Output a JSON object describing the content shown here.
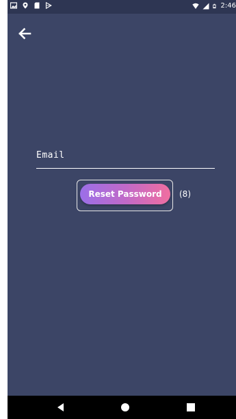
{
  "status_bar": {
    "left_icons": [
      "image-icon",
      "location-pin-icon",
      "sd-card-icon",
      "play-store-icon"
    ],
    "right_icons": [
      "wifi-icon",
      "signal-icon",
      "battery-icon"
    ],
    "time": "2:46"
  },
  "nav": {
    "back_icon": "arrow-left-icon"
  },
  "form": {
    "email_placeholder": "Email",
    "reset_label": "Reset Password",
    "element_index": "(8)"
  },
  "colors": {
    "background": "#3c4566",
    "status_bar": "#2e3653",
    "button_gradient_start": "#9b6fe8",
    "button_gradient_end": "#f06ea0",
    "nav_bar": "#000000"
  },
  "system_nav": {
    "icons": [
      "back-triangle-icon",
      "home-circle-icon",
      "recents-square-icon"
    ]
  }
}
